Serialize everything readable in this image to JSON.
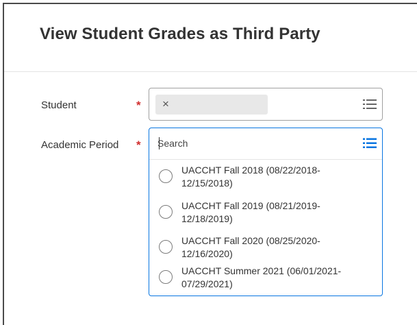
{
  "page": {
    "title": "View Student Grades as Third Party"
  },
  "form": {
    "student_label": "Student",
    "student_required": "*",
    "student_remove": "×",
    "period_label": "Academic Period",
    "period_required": "*",
    "search_placeholder": "Search"
  },
  "options": [
    {
      "line1": "UACCHT Fall 2018 (08/22/2018-",
      "line2": "12/15/2018)"
    },
    {
      "line1": "UACCHT Fall 2019 (08/21/2019-",
      "line2": "12/18/2019)"
    },
    {
      "line1": "UACCHT Fall 2020 (08/25/2020-",
      "line2": "12/16/2020)"
    },
    {
      "line1": "UACCHT Summer 2021 (06/01/2021-",
      "line2": "07/29/2021)"
    }
  ],
  "colors": {
    "accent": "#0875e1",
    "required": "#d12f2f",
    "icon_gray": "#666666"
  },
  "icons": {
    "student_prompt": "prompt-list-icon",
    "period_prompt": "prompt-list-icon"
  }
}
